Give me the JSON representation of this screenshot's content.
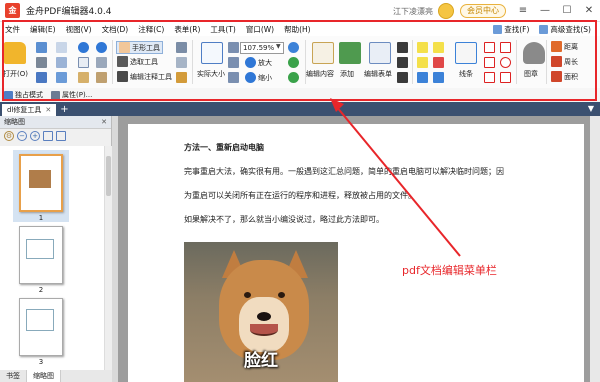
{
  "app": {
    "icon_text": "金",
    "title": "金舟PDF编辑器4.0.4",
    "user": "江下凌漂亮",
    "vip_label": "会员中心"
  },
  "window_controls": {
    "menu": "≡",
    "minimize": "—",
    "maximize": "☐",
    "close": "✕"
  },
  "menu": [
    "文件",
    "编辑(E)",
    "视图(V)",
    "文档(D)",
    "注释(C)",
    "表单(R)",
    "工具(T)",
    "窗口(W)",
    "帮助(H)"
  ],
  "menu_right": {
    "find": "查找(F)",
    "advanced_find": "高级查找(S)"
  },
  "ribbon": {
    "open": "打开(O)",
    "hand_tool": "手形工具",
    "select_tool": "选取工具",
    "edit_annot_tool": "编辑注释工具",
    "actual_size": "实际大小",
    "zoom_value": "107.59%",
    "zoom_in": "放大",
    "zoom_out": "缩小",
    "edit_content": "编辑内容",
    "add": "添加",
    "edit_form": "编辑表单",
    "line": "线条",
    "stamp": "图章",
    "distance": "距离",
    "perimeter": "周长",
    "area": "面积"
  },
  "subbar": {
    "exclusive_mode": "独占模式",
    "properties": "属性(P)..."
  },
  "tabs": {
    "doc_tab": "dl修复工具",
    "add": "+",
    "pin": "▼"
  },
  "left_panel": {
    "title": "缩略图",
    "thumb_pages": [
      "1",
      "2",
      "3"
    ],
    "bottom_tabs": [
      "书签",
      "缩略图"
    ]
  },
  "document": {
    "heading": "方法一、重新启动电脑",
    "lines": [
      "完事重启大法，确实很有用。一般遇到这汇总问题，简单的重启电脑可以解决临时问题；因",
      "为重启可以关闭所有正在运行的程序和进程，释放被占用的文件。",
      "如果解决不了，那么就当小编没说过，略过此方法即可。"
    ],
    "image_caption": "脸红"
  },
  "annotation": {
    "text": "pdf文档编辑菜单栏",
    "color": "#e8262a"
  },
  "colors": {
    "frame": "#e8262a",
    "tabbar": "#3b5070",
    "doc_bg": "#9d9d9d"
  }
}
